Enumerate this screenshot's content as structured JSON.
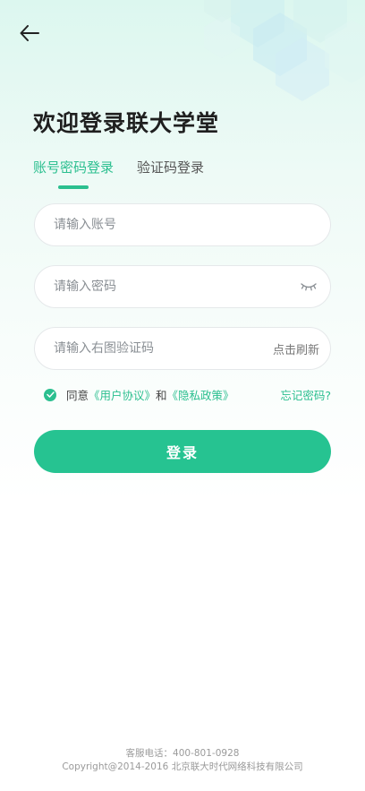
{
  "header": {
    "back_icon": "arrow-left-icon",
    "title": "欢迎登录联大学堂"
  },
  "tabs": [
    {
      "label": "账号密码登录",
      "active": true
    },
    {
      "label": "验证码登录",
      "active": false
    }
  ],
  "form": {
    "account_placeholder": "请输入账号",
    "password_placeholder": "请输入密码",
    "password_toggle_icon": "eye-closed-icon",
    "captcha_placeholder": "请输入右图验证码",
    "captcha_refresh": "点击刷新"
  },
  "agreement": {
    "checked": true,
    "prefix": "同意",
    "user_agreement": "《用户协议》",
    "conjunction": "和",
    "privacy_policy": "《隐私政策》",
    "forgot_password": "忘记密码?"
  },
  "login_button": "登录",
  "footer": {
    "hotline": "客服电话：400-801-0928",
    "copyright": "Copyright@2014-2016 北京联大时代网络科技有限公司"
  },
  "colors": {
    "accent": "#26c391",
    "background_tint": "#dcf7ef"
  }
}
